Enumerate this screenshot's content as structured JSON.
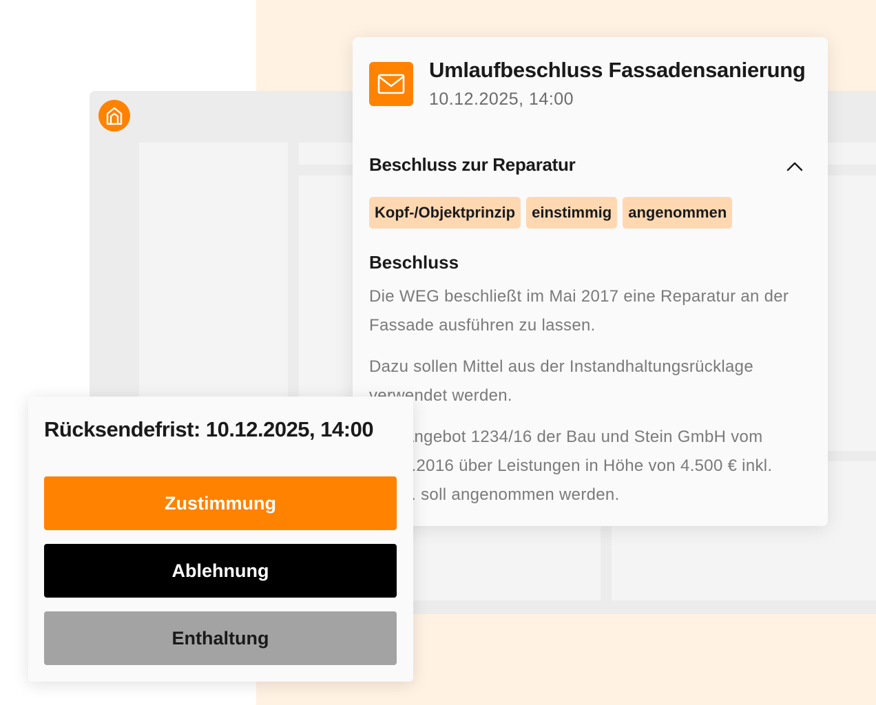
{
  "card": {
    "title": "Umlaufbeschluss Fassadensanierung",
    "date": "10.12.2025, 14:00",
    "section_title": "Beschluss zur Reparatur",
    "tags": [
      "Kopf-/Objektprinzip",
      "einstimmig",
      "angenommen"
    ],
    "subheading": "Beschluss",
    "paragraphs": [
      "Die WEG beschließt im Mai 2017 eine Reparatur an der Fassade ausführen zu lassen.",
      "Dazu sollen Mittel aus der Instandhaltungsrücklage verwendet werden.",
      "Das Angebot 1234/16 der Bau und Stein GmbH vom 15.12.2016 über Leistungen in Höhe von 4.500 € inkl. MwSt. soll angenommen werden."
    ]
  },
  "vote": {
    "deadline": "Rücksendefrist: 10.12.2025, 14:00",
    "approve_label": "Zustimmung",
    "reject_label": "Ablehnung",
    "abstain_label": "Enthaltung"
  },
  "icons": {
    "logo": "house-logo-icon",
    "mail": "mail-icon",
    "collapse": "chevron-up-icon"
  },
  "colors": {
    "accent": "#ff8200",
    "tag_bg": "#ffd8b2",
    "page_bg": "#fff2e3",
    "reject": "#000000",
    "abstain": "#a3a3a3"
  }
}
